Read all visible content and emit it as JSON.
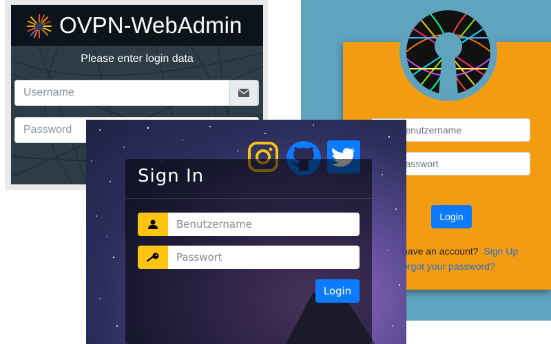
{
  "panel1": {
    "title": "OVPN-WebAdmin",
    "subtitle": "Please enter login data",
    "username_placeholder": "Username",
    "password_placeholder": "Password",
    "icons": {
      "logo": "ovpn-burst-logo",
      "user_addon": "envelope-icon"
    },
    "colors": {
      "header": "#0b141b",
      "card": "#2d3d48"
    }
  },
  "panel2": {
    "username_placeholder": "Benutzername",
    "password_placeholder": "Passwort",
    "login_label": "Login",
    "no_account_text": "have an account?",
    "signup_label": "Sign Up",
    "forgot_label": "orgot your password?",
    "icons": {
      "logo": "openvpn-keyhole-logo"
    },
    "colors": {
      "background": "#5fa3bf",
      "card": "#f39c12",
      "button": "#0d7bff",
      "link": "#1f6fd6"
    }
  },
  "panel3": {
    "title": "Sign In",
    "username_placeholder": "Benutzername",
    "password_placeholder": "Passwort",
    "login_label": "Login",
    "icons": {
      "instagram": "instagram-icon",
      "github": "github-icon",
      "twitter": "twitter-icon",
      "user_addon": "user-icon",
      "pass_addon": "key-icon"
    },
    "colors": {
      "accent": "#ffc312",
      "button": "#0d7bff",
      "github": "#0d7bff",
      "twitter": "#0d7bff"
    }
  }
}
